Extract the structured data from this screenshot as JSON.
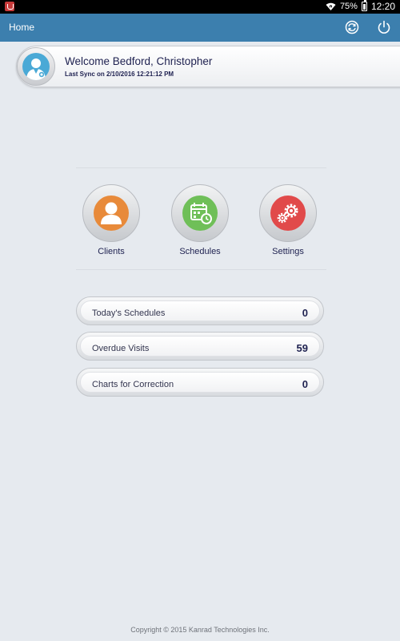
{
  "status_bar": {
    "battery": "75%",
    "time": "12:20"
  },
  "app_bar": {
    "title": "Home"
  },
  "welcome": {
    "greeting": "Welcome Bedford, Christopher",
    "last_sync": "Last Sync on 2/10/2016 12:21:12 PM"
  },
  "nav": {
    "clients": "Clients",
    "schedules": "Schedules",
    "settings": "Settings"
  },
  "summary": [
    {
      "label": "Today's Schedules",
      "count": "0"
    },
    {
      "label": "Overdue Visits",
      "count": "59"
    },
    {
      "label": "Charts for Correction",
      "count": "0"
    }
  ],
  "colors": {
    "app_bar": "#3c7fae",
    "clients": "#e88a3a",
    "schedules": "#6fbf58",
    "settings": "#e14a4a",
    "avatar": "#4aa9d6"
  },
  "footer": "Copyright © 2015 Kanrad Technologies Inc."
}
